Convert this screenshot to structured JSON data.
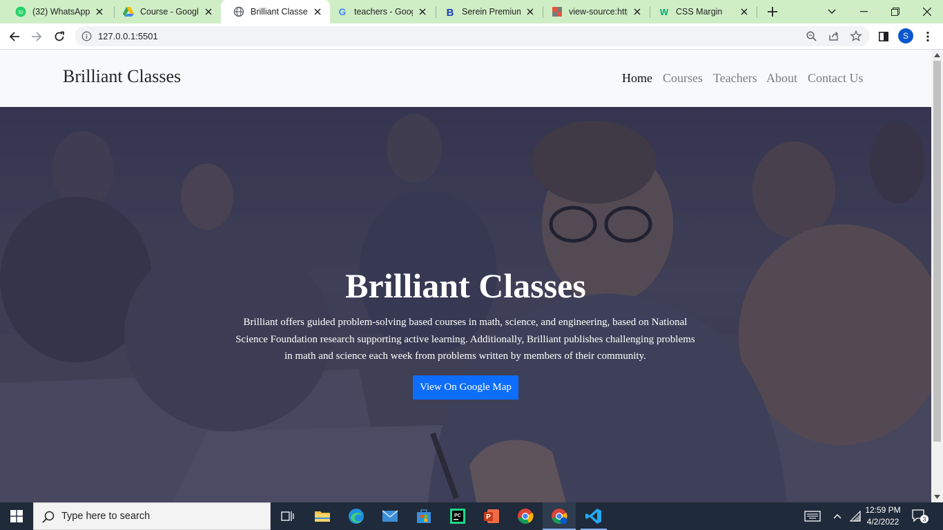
{
  "browser": {
    "tabs": [
      {
        "title": "(32) WhatsApp",
        "icon": "whatsapp-icon",
        "badge": "32"
      },
      {
        "title": "Course - Google",
        "icon": "google-drive-icon"
      },
      {
        "title": "Brilliant Classes",
        "icon": "globe-icon"
      },
      {
        "title": "teachers - Googl",
        "icon": "google-icon"
      },
      {
        "title": "Serein Premium",
        "icon": "bootstrap-icon"
      },
      {
        "title": "view-source:http",
        "icon": "source-icon"
      },
      {
        "title": "CSS Margin",
        "icon": "w3schools-icon"
      }
    ],
    "address": "127.0.0.1:5501",
    "profile_initial": "S"
  },
  "site": {
    "brand": "Brilliant Classes",
    "nav": [
      "Home",
      "Courses",
      "Teachers",
      "About",
      "Contact Us"
    ],
    "hero": {
      "title": "Brilliant Classes",
      "text": "Brilliant offers guided problem-solving based courses in math, science, and engineering, based on National Science Foundation research supporting active learning. Additionally, Brilliant publishes challenging problems in math and science each week from problems written by members of their community.",
      "button": "View On Google Map"
    }
  },
  "taskbar": {
    "search_placeholder": "Type here to search",
    "time": "12:59 PM",
    "date": "4/2/2022",
    "notification_count": "3"
  },
  "colors": {
    "tabstrip": "#cfeec6",
    "accent_button": "#0d6efd",
    "navbar_bg": "#f8f9fa",
    "taskbar": "#1f2a3a"
  }
}
